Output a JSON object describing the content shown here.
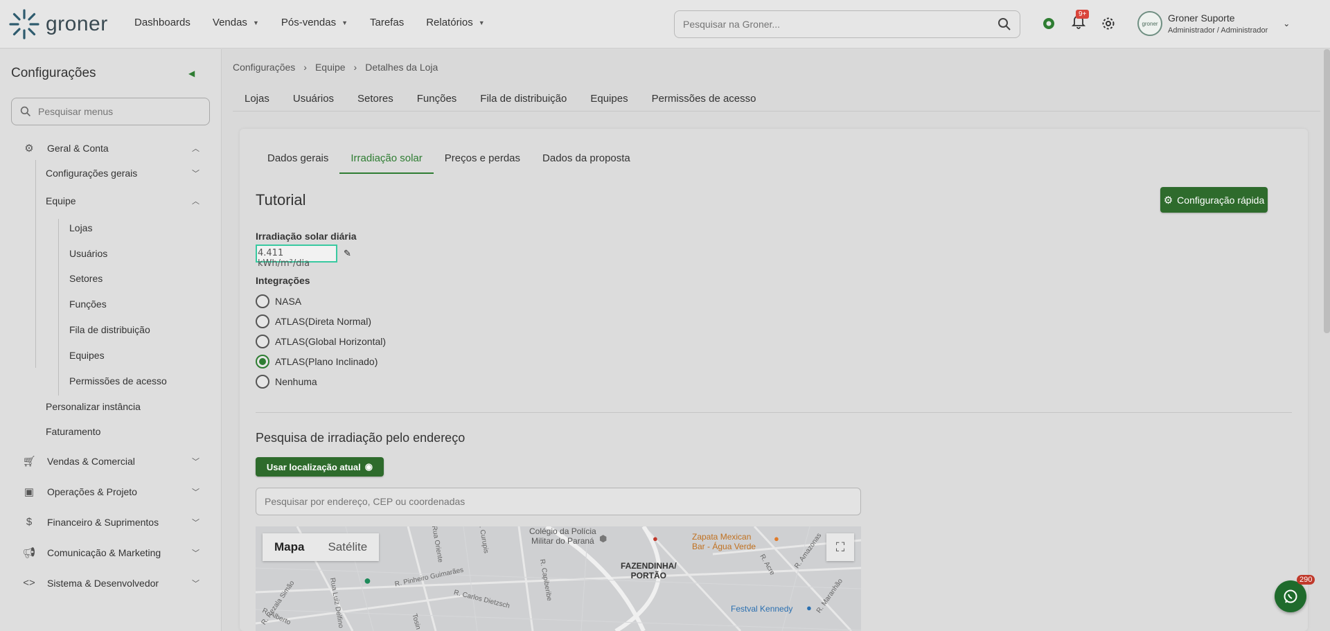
{
  "app": {
    "logo_text": "groner"
  },
  "nav": {
    "items": [
      {
        "label": "Dashboards",
        "dropdown": false
      },
      {
        "label": "Vendas",
        "dropdown": true
      },
      {
        "label": "Pós-vendas",
        "dropdown": true
      },
      {
        "label": "Tarefas",
        "dropdown": false
      },
      {
        "label": "Relatórios",
        "dropdown": true
      }
    ],
    "search_placeholder": "Pesquisar na Groner...",
    "notifications_badge": "9+",
    "user_name": "Groner Suporte",
    "user_role": "Administrador / Administrador",
    "avatar_text": "groner"
  },
  "sidebar": {
    "title": "Configurações",
    "search_placeholder": "Pesquisar menus",
    "sections": [
      {
        "label": "Geral & Conta",
        "icon": "gear-icon",
        "expanded": true
      },
      {
        "label": "Vendas & Comercial",
        "icon": "cart-icon",
        "expanded": false
      },
      {
        "label": "Operações & Projeto",
        "icon": "toolbox-icon",
        "expanded": false
      },
      {
        "label": "Financeiro & Suprimentos",
        "icon": "dollar-icon",
        "expanded": false
      },
      {
        "label": "Comunicação & Marketing",
        "icon": "megaphone-icon",
        "expanded": false
      },
      {
        "label": "Sistema & Desenvolvedor",
        "icon": "code-icon",
        "expanded": false
      }
    ],
    "geral_items": {
      "config_gerais": "Configurações gerais",
      "equipe": "Equipe",
      "personalizar": "Personalizar instância",
      "faturamento": "Faturamento"
    },
    "equipe_items": [
      "Lojas",
      "Usuários",
      "Setores",
      "Funções",
      "Fila de distribuição",
      "Equipes",
      "Permissões de acesso"
    ]
  },
  "breadcrumb": [
    "Configurações",
    "Equipe",
    "Detalhes da Loja"
  ],
  "top_tabs": [
    "Lojas",
    "Usuários",
    "Setores",
    "Funções",
    "Fila de distribuição",
    "Equipes",
    "Permissões de acesso"
  ],
  "inner_tabs": [
    {
      "label": "Dados gerais",
      "active": false
    },
    {
      "label": "Irradiação solar",
      "active": true
    },
    {
      "label": "Preços e perdas",
      "active": false
    },
    {
      "label": "Dados da proposta",
      "active": false
    }
  ],
  "content": {
    "tutorial_title": "Tutorial",
    "quick_config_label": "Configuração rápida",
    "irradiation_label": "Irradiação solar diária",
    "irradiation_value": "4.411 kWh/m²/dia",
    "integrations_label": "Integrações",
    "integrations": [
      {
        "label": "NASA",
        "selected": false
      },
      {
        "label": "ATLAS(Direta Normal)",
        "selected": false
      },
      {
        "label": "ATLAS(Global Horizontal)",
        "selected": false
      },
      {
        "label": "ATLAS(Plano Inclinado)",
        "selected": true
      },
      {
        "label": "Nenhuma",
        "selected": false
      }
    ],
    "address_search_title": "Pesquisa de irradiação pelo endereço",
    "use_location_label": "Usar localização atual",
    "address_placeholder": "Pesquisar por endereço, CEP ou coordenadas"
  },
  "map": {
    "type_map": "Mapa",
    "type_satellite": "Satélite",
    "places": {
      "colegio_1": "Colégio da Polícia",
      "colegio_2": "Militar do Paraná",
      "zapata_1": "Zapata Mexican",
      "zapata_2": "Bar - Água Verde",
      "fazendinha_1": "FAZENDINHA/",
      "fazendinha_2": "PORTÃO",
      "festval": "Festval Kennedy",
      "pinheiro": "R. Pinheiro Guimarães",
      "carlos": "R. Carlos Dietzsch",
      "capiberibe": "R. Capiberibe",
      "rezala": "R. Rezala Simão",
      "luiz": "Rua Luiz Delfino",
      "alberto": "R. Alberto",
      "tosin": "Tosin",
      "acre": "R. Acre",
      "amazonas": "R. Amazonas",
      "maranhao": "R. Maranhão",
      "oriente": "Rua Oriente",
      "curupis": "R. Curupis"
    }
  },
  "whatsapp_badge": "290",
  "colors": {
    "accent": "#2e7d32",
    "button": "#2e6b2c",
    "focus": "#38c9a0",
    "badge": "#d9453b"
  }
}
